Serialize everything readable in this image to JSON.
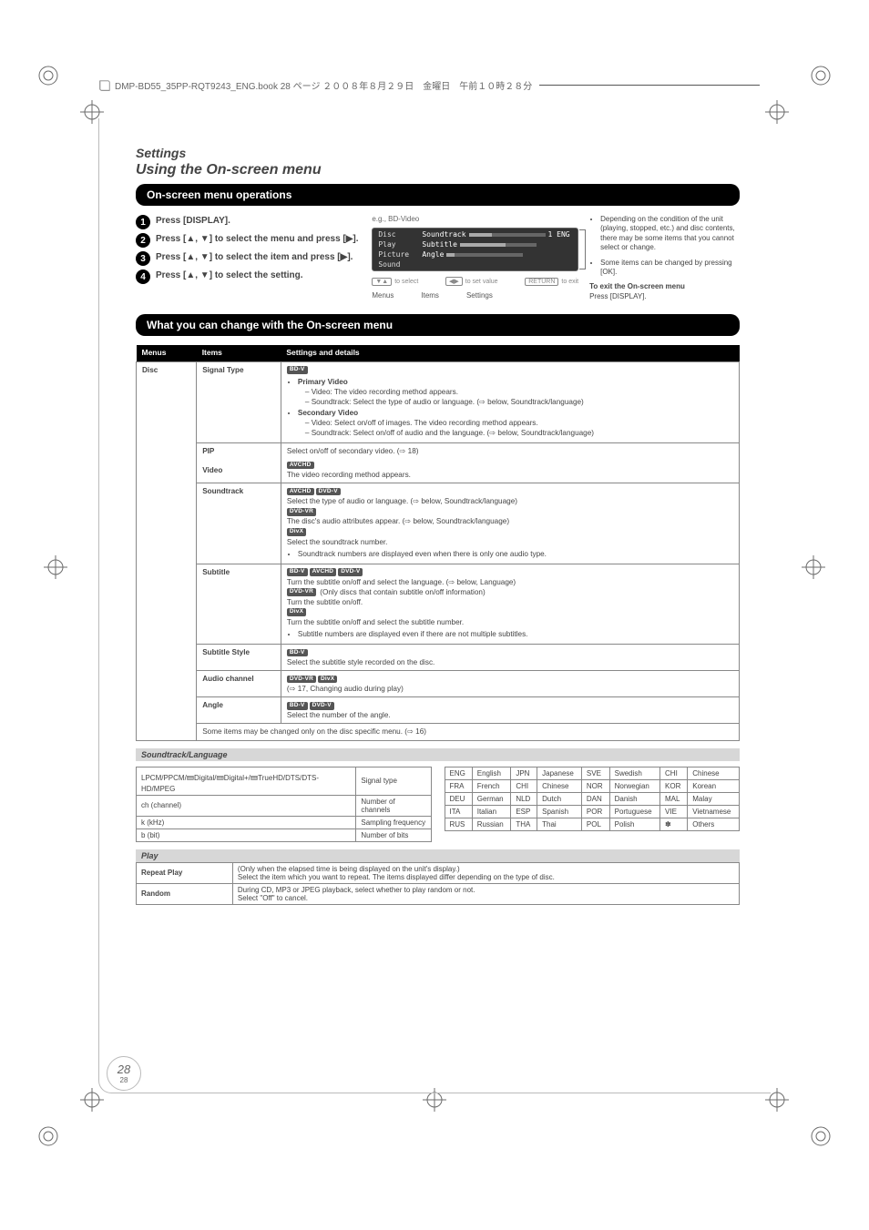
{
  "header": {
    "docstring": "DMP-BD55_35PP-RQT9243_ENG.book  28 ページ  ２００８年８月２９日　金曜日　午前１０時２８分"
  },
  "page_section": "Settings",
  "heading_top": "Using the On-screen menu",
  "heading_ops": "On-screen menu operations",
  "steps": {
    "s1": {
      "lead": "Press [DISPLAY]."
    },
    "s2": {
      "lead": "Press [▲, ▼] to select the menu and press [▶].",
      "arrow": "▶"
    },
    "s3": {
      "lead": "Press [▲, ▼] to select the item and press [▶].",
      "arrow": "▶"
    },
    "s4": {
      "lead": "Press [▲, ▼] to select the setting."
    }
  },
  "osd": {
    "rows": [
      {
        "label": "Disc",
        "key": "Soundtrack",
        "val": "1 ENG"
      },
      {
        "label": "Play",
        "key": "Subtitle",
        "val": ""
      },
      {
        "label": "Picture",
        "key": "Angle",
        "val": ""
      },
      {
        "label": "Sound",
        "key": "",
        "val": ""
      }
    ],
    "tips": {
      "left": {
        "btn": "▼▲",
        "txt": "to select"
      },
      "mid": {
        "btn": "◀▶",
        "txt": "to set value"
      },
      "right": {
        "btn": "RETURN",
        "txt": "to exit"
      }
    },
    "under_labels": {
      "menus": "Menus",
      "items": "Items",
      "settings": "Settings"
    }
  },
  "right_notes": [
    "Depending on the condition of the unit (playing, stopped, etc.) and disc contents, there may be some items that you cannot select or change.",
    "Some items can be changed by pressing [OK]."
  ],
  "right_exit": "To exit the On-screen menu",
  "right_exit_body": "Press [DISPLAY].",
  "heading_menu": "What you can change with the On-screen menu",
  "table_head": {
    "menus": "Menus",
    "items": "Items",
    "details": "Settings and details"
  },
  "cat_disc": "Disc",
  "rows_disc": {
    "signal_type": {
      "label": "Signal Type",
      "lines": [
        "Primary Video",
        "Video: The video recording method appears.",
        "Soundtrack: Select the type of audio or language. (⇨ below, Soundtrack/language)",
        "Secondary Video",
        "Video: Select on/off of images. The video recording method appears.",
        "Soundtrack: Select on/off of audio and the language. (⇨ below, Soundtrack/language)"
      ]
    },
    "pip": {
      "label": "PIP",
      "line": "Select on/off of secondary video. (⇨ 18)"
    },
    "video": {
      "label": "Video",
      "line": "The video recording method appears.",
      "badges": [
        "AVCHD"
      ]
    },
    "soundtrack": {
      "label": "Soundtrack",
      "badges1": [
        "AVCHD",
        "DVD-V"
      ],
      "line1": "Select the type of audio or language. (⇨ below, Soundtrack/language)",
      "badges2": [
        "DVD-VR"
      ],
      "line2": "The disc's audio attributes appear. (⇨ below, Soundtrack/language)",
      "badges3": [
        "DivX"
      ],
      "line3": "Select the soundtrack number.",
      "bullet": "Soundtrack numbers are displayed even when there is only one audio type."
    },
    "subtitle": {
      "label": "Subtitle",
      "badges1": [
        "BD-V",
        "AVCHD",
        "DVD-V"
      ],
      "line1": "Turn the subtitle on/off and select the language. (⇨ below, Language)",
      "badges2": [
        "DVD-VR"
      ],
      "line2": "(Only discs that contain subtitle on/off information)",
      "line2b": "Turn the subtitle on/off.",
      "badges3": [
        "DivX"
      ],
      "line3": "Turn the subtitle on/off and select the subtitle number.",
      "bullet": "Subtitle numbers are displayed even if there are not multiple subtitles."
    },
    "subtitle_style": {
      "label": "Subtitle Style",
      "badges": [
        "BD-V"
      ],
      "line": "Select the subtitle style recorded on the disc."
    },
    "audio_ch": {
      "label": "Audio channel",
      "badges": [
        "DVD-VR",
        "DivX"
      ],
      "line": "(⇨ 17, Changing audio during play)"
    },
    "angle": {
      "label": "Angle",
      "badges": [
        "BD-V",
        "DVD-V"
      ],
      "line": "Select the number of the angle."
    }
  },
  "table_foot": "Some items may be changed only on the disc specific menu. (⇨ 16)",
  "lang_heading": "Soundtrack/Language",
  "soundtrack_rows": [
    [
      "LPCM/PPCM/🝚Digital/🝚Digital+/🝚TrueHD/DTS/DTS-HD/MPEG",
      "Signal type"
    ],
    [
      "ch (channel)",
      "Number of channels"
    ],
    [
      "k (kHz)",
      "Sampling frequency"
    ],
    [
      "b (bit)",
      "Number of bits"
    ]
  ],
  "language_rows": [
    [
      "ENG",
      "English",
      "JPN",
      "Japanese",
      "SVE",
      "Swedish",
      "CHI",
      "Chinese"
    ],
    [
      "FRA",
      "French",
      "CHI",
      "Chinese",
      "NOR",
      "Norwegian",
      "KOR",
      "Korean"
    ],
    [
      "DEU",
      "German",
      "NLD",
      "Dutch",
      "DAN",
      "Danish",
      "MAL",
      "Malay"
    ],
    [
      "ITA",
      "Italian",
      "ESP",
      "Spanish",
      "POR",
      "Portuguese",
      "VIE",
      "Vietnamese"
    ],
    [
      "RUS",
      "Russian",
      "THA",
      "Thai",
      "POL",
      "Polish",
      "✽",
      "Others"
    ]
  ],
  "play_heading": "Play",
  "play_rows": {
    "repeat": {
      "label": "Repeat Play",
      "line": "(Only when the elapsed time is being displayed on the unit's display.)",
      "line2": "Select the item which you want to repeat. The items displayed differ depending on the type of disc."
    },
    "random": {
      "label": "Random",
      "line": "During CD, MP3 or JPEG playback, select whether to play random or not.",
      "note": "Select \"Off\" to cancel."
    }
  },
  "page_num": {
    "big": "28",
    "small": "28"
  }
}
